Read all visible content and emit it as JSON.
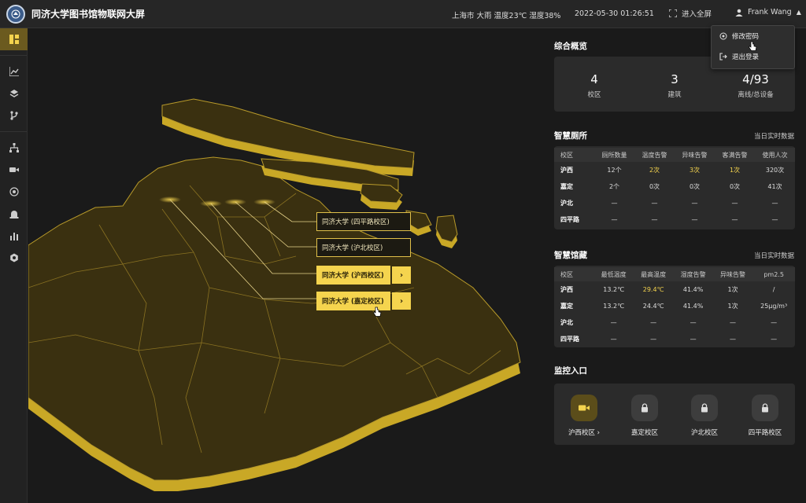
{
  "app": {
    "title": "同济大学图书馆物联网大屏"
  },
  "header": {
    "weather": "上海市 大雨 温度23℃ 湿度38%",
    "datetime": "2022-05-30 01:26:51",
    "fullscreen_label": "进入全屏",
    "user_name": "Frank Wang"
  },
  "user_menu": {
    "items": [
      {
        "label": "修改密码",
        "icon": "settings-icon"
      },
      {
        "label": "退出登录",
        "icon": "logout-icon"
      }
    ]
  },
  "sidebar": {
    "items": [
      {
        "icon": "dashboard-icon",
        "active": true
      },
      {
        "icon": "chart-icon"
      },
      {
        "icon": "layers-icon"
      },
      {
        "icon": "branch-icon"
      },
      {
        "icon": "hierarchy-icon"
      },
      {
        "icon": "video-icon"
      },
      {
        "icon": "network-icon"
      },
      {
        "icon": "alarm-icon"
      },
      {
        "icon": "bar-chart-icon"
      },
      {
        "icon": "settings-icon"
      }
    ]
  },
  "map": {
    "campus_labels": [
      {
        "label": "同济大学 (四平路校区)",
        "active": false
      },
      {
        "label": "同济大学 (沪北校区)",
        "active": false
      },
      {
        "label": "同济大学 (沪西校区)",
        "active": true,
        "arrow": "›"
      },
      {
        "label": "同济大学 (嘉定校区)",
        "active": true,
        "arrow": "›"
      }
    ]
  },
  "overview": {
    "title": "综合概览",
    "stats": [
      {
        "value": "4",
        "label": "校区"
      },
      {
        "value": "3",
        "label": "建筑"
      },
      {
        "value": "4/93",
        "label": "离线/总设备"
      }
    ]
  },
  "toilet": {
    "title": "智慧厕所",
    "subtitle": "当日实时数据",
    "columns": [
      "校区",
      "厕所数量",
      "温度告警",
      "异味告警",
      "客满告警",
      "使用人次"
    ],
    "rows": [
      [
        "沪西",
        "12个",
        "2次",
        "3次",
        "1次",
        "320次"
      ],
      [
        "嘉定",
        "2个",
        "0次",
        "0次",
        "0次",
        "41次"
      ],
      [
        "沪北",
        "—",
        "—",
        "—",
        "—",
        "—"
      ],
      [
        "四平路",
        "—",
        "—",
        "—",
        "—",
        "—"
      ]
    ]
  },
  "collection": {
    "title": "智慧馆藏",
    "subtitle": "当日实时数据",
    "columns": [
      "校区",
      "最低温度",
      "最高温度",
      "湿度告警",
      "异味告警",
      "pm2.5"
    ],
    "rows": [
      [
        "沪西",
        "13.2℃",
        "29.4℃",
        "41.4%",
        "1次",
        "/"
      ],
      [
        "嘉定",
        "13.2℃",
        "24.4℃",
        "41.4%",
        "1次",
        "25μg/m³"
      ],
      [
        "沪北",
        "—",
        "—",
        "—",
        "—",
        "—"
      ],
      [
        "四平路",
        "—",
        "—",
        "—",
        "—",
        "—"
      ]
    ]
  },
  "monitor": {
    "title": "监控入口",
    "items": [
      {
        "label": "沪西校区 ›",
        "icon": "video-icon",
        "active": true
      },
      {
        "label": "嘉定校区",
        "icon": "lock-icon"
      },
      {
        "label": "沪北校区",
        "icon": "lock-icon"
      },
      {
        "label": "四平路校区",
        "icon": "lock-icon"
      }
    ]
  },
  "colors": {
    "accent": "#f5d44e",
    "map_fill": "#3a3010",
    "map_edge": "#c9a826",
    "background": "#1a1a1a"
  }
}
